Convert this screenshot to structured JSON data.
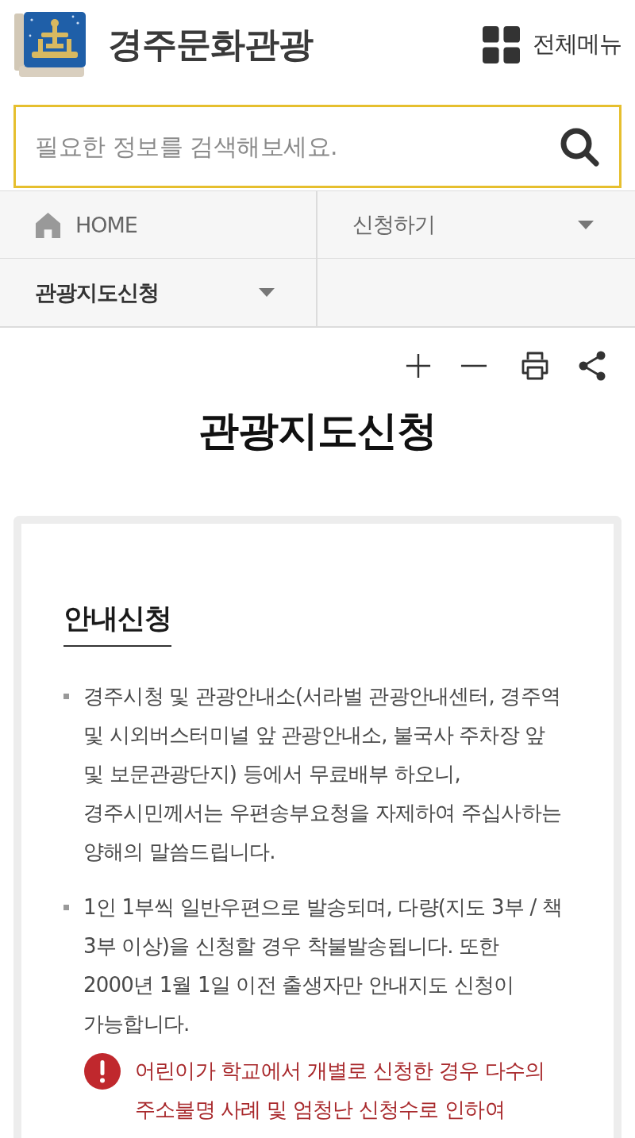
{
  "header": {
    "site_title": "경주문화관광",
    "menu_label": "전체메뉴"
  },
  "search": {
    "placeholder": "필요한 정보를 검색해보세요."
  },
  "breadcrumb": [
    {
      "kind": "home",
      "label": "HOME",
      "current": false
    },
    {
      "kind": "dropdown",
      "label": "신청하기",
      "current": false
    },
    {
      "kind": "dropdown",
      "label": "관광지도신청",
      "current": true
    }
  ],
  "page_title": "관광지도신청",
  "section": {
    "heading": "안내신청",
    "bullets": [
      {
        "text": "경주시청 및 관광안내소(서라벌 관광안내센터, 경주역 및 시외버스터미널 앞 관광안내소, 불국사 주차장 앞 및 보문관광단지) 등에서 무료배부 하오니, 경주시민께서는 우편송부요청을 자제하여 주십사하는 양해의 말씀드립니다."
      },
      {
        "text": "1인 1부씩 일반우편으로 발송되며, 다량(지도 3부 / 책 3부 이상)을 신청할 경우 착불발송됩니다. 또한 2000년 1월 1일 이전 출생자만 안내지도 신청이 가능합니다.",
        "warning": "어린이가 학교에서 개별로 신청한 경우 다수의 주소불명 사례 및 엄청난 신청수로 인하여"
      }
    ]
  }
}
